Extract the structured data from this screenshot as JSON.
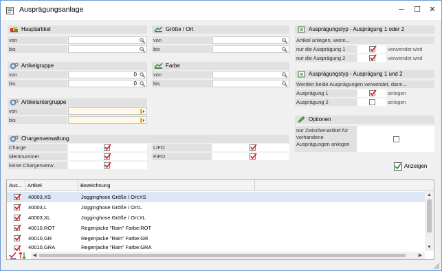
{
  "window": {
    "title": "Ausprägungsanlage",
    "minimize": "─",
    "maximize": "☐",
    "close": "✕"
  },
  "hauptartikel": {
    "title": "Hauptartikel",
    "von_label": "von",
    "bis_label": "bis",
    "von_value": "",
    "bis_value": ""
  },
  "groesse": {
    "title": "Größe / Ort",
    "von_label": "von",
    "bis_label": "bis",
    "von_value": "",
    "bis_value": ""
  },
  "artikelgruppe": {
    "title": "Artikelgruppe",
    "von_label": "von",
    "bis_label": "bis",
    "von_value": "0",
    "bis_value": "0"
  },
  "farbe": {
    "title": "Farbe",
    "von_label": "von",
    "bis_label": "bis",
    "von_value": "",
    "bis_value": ""
  },
  "artikeluntergruppe": {
    "title": "Artikeluntergruppe",
    "von_label": "von",
    "bis_label": "bis"
  },
  "chargen": {
    "title": "Chargenverwaltung",
    "charge": "Charge",
    "identnummer": "Identnummer",
    "keine": "keine Chargenverw.",
    "lifo": "LIFO",
    "fifo": "FIFO"
  },
  "typ1oder2": {
    "title": "Ausprägungstyp - Ausprägung 1 oder 2",
    "hint": "Artikel anlegen, wenn...",
    "nur1": "nur die Ausprägung 1",
    "nur2": "nur die Ausprägung 2",
    "status1": "verwendet wird",
    "status2": "verwendet wird"
  },
  "typ1und2": {
    "title": "Ausprägungstyp - Ausprägung 1 und 2",
    "hint": "Werden beide Ausprägungen verwendet, dann...",
    "a1": "Ausprägung 1",
    "a2": "Ausprägung 2",
    "status1": "anlegen",
    "status2": "anlegen"
  },
  "optionen": {
    "title": "Optionen",
    "zwischen_l1": "nur Zwischenartikel für",
    "zwischen_l2": "vorhandene",
    "zwischen_l3": "Ausprägungen anlegen"
  },
  "anzeigen": {
    "label": "Anzeigen"
  },
  "table": {
    "headers": [
      "Aus...",
      "Artikel",
      "Bezeichnung"
    ],
    "rows": [
      {
        "artikel": "40003,XS",
        "bezeichnung": "Jogginghose Größe / Ort:XS"
      },
      {
        "artikel": "40003,L",
        "bezeichnung": "Jogginghose Größe / Ort:L"
      },
      {
        "artikel": "40003,XL",
        "bezeichnung": "Jogginghose Größe / Ort:XL"
      },
      {
        "artikel": "40010,ROT",
        "bezeichnung": "Regenjacke \"Rain\" Farbe:ROT"
      },
      {
        "artikel": "40010,GR",
        "bezeichnung": "Regenjacke \"Rain\" Farbe:GR"
      },
      {
        "artikel": "40010,GRA",
        "bezeichnung": "Regenjacke \"Rain\" Farbe:GRA"
      }
    ]
  },
  "colors": {
    "check": "#d42020",
    "section_header": "#e1e1e1",
    "selection": "#dce7f5"
  }
}
